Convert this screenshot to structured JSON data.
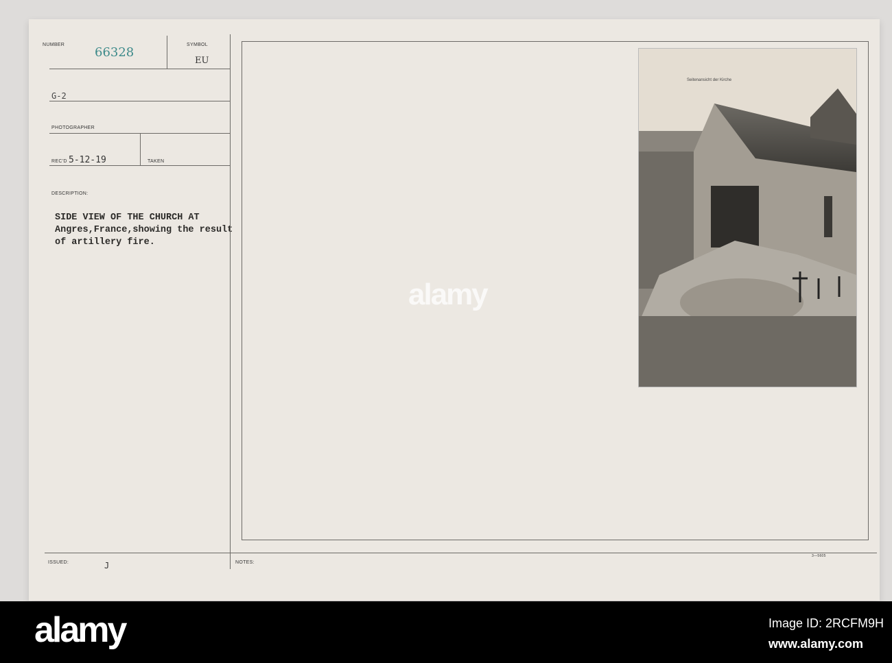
{
  "card": {
    "number_label": "NUMBER",
    "number": "66328",
    "symbol_label": "SYMBOL",
    "symbol": "EU",
    "unit": "G-2",
    "photographer_label": "PHOTOGRAPHER",
    "recd_label": "REC'D",
    "recd_date": "5-12-19",
    "taken_label": "TAKEN",
    "description_label": "DESCRIPTION:",
    "description_lines": [
      "SIDE VIEW OF THE CHURCH AT",
      "Angres,France,showing the result",
      "of artillery fire."
    ],
    "issued_label": "ISSUED:",
    "issued": "J",
    "notes_label": "NOTES:",
    "form_number": "3—5605",
    "photo_caption": "Seitenansicht der Kirche"
  },
  "watermark": {
    "brand": "alamy",
    "image_id": "Image ID: 2RCFM9H",
    "url": "www.alamy.com"
  },
  "colors": {
    "number_ink": "#3d8a8a",
    "paper": "#ece8e2"
  }
}
